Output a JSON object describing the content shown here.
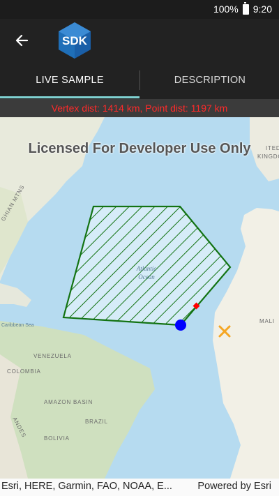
{
  "status_bar": {
    "battery": "100%",
    "time": "9:20"
  },
  "app_bar": {
    "logo_text": "SDK"
  },
  "tabs": [
    {
      "label": "LIVE SAMPLE"
    },
    {
      "label": "DESCRIPTION"
    }
  ],
  "distance_text": "Vertex dist: 1414 km, Point dist: 1197 km",
  "map": {
    "watermark": "Licensed For Developer Use Only",
    "labels": {
      "atlantic": "Atlantic",
      "ocean": "Ocean",
      "caribbean": "Caribbean Sea",
      "venezuela": "VENEZUELA",
      "colombia": "COLOMBIA",
      "amazon": "AMAZON BASIN",
      "brazil": "BRAZIL",
      "bolivia": "BOLIVIA",
      "andes": "ANDES",
      "mali": "MALI",
      "kingdom": "KINGDOM",
      "ited": "ITED",
      "mtns": "GHIAN MTNS"
    },
    "colors": {
      "polygon_stroke": "#137313",
      "vertex_point": "#0000ff",
      "nearest_point": "#ff0000",
      "tap_point": "#f5a623"
    }
  },
  "attribution": {
    "left": "Esri, HERE, Garmin, FAO, NOAA, E...",
    "right": "Powered by Esri"
  }
}
